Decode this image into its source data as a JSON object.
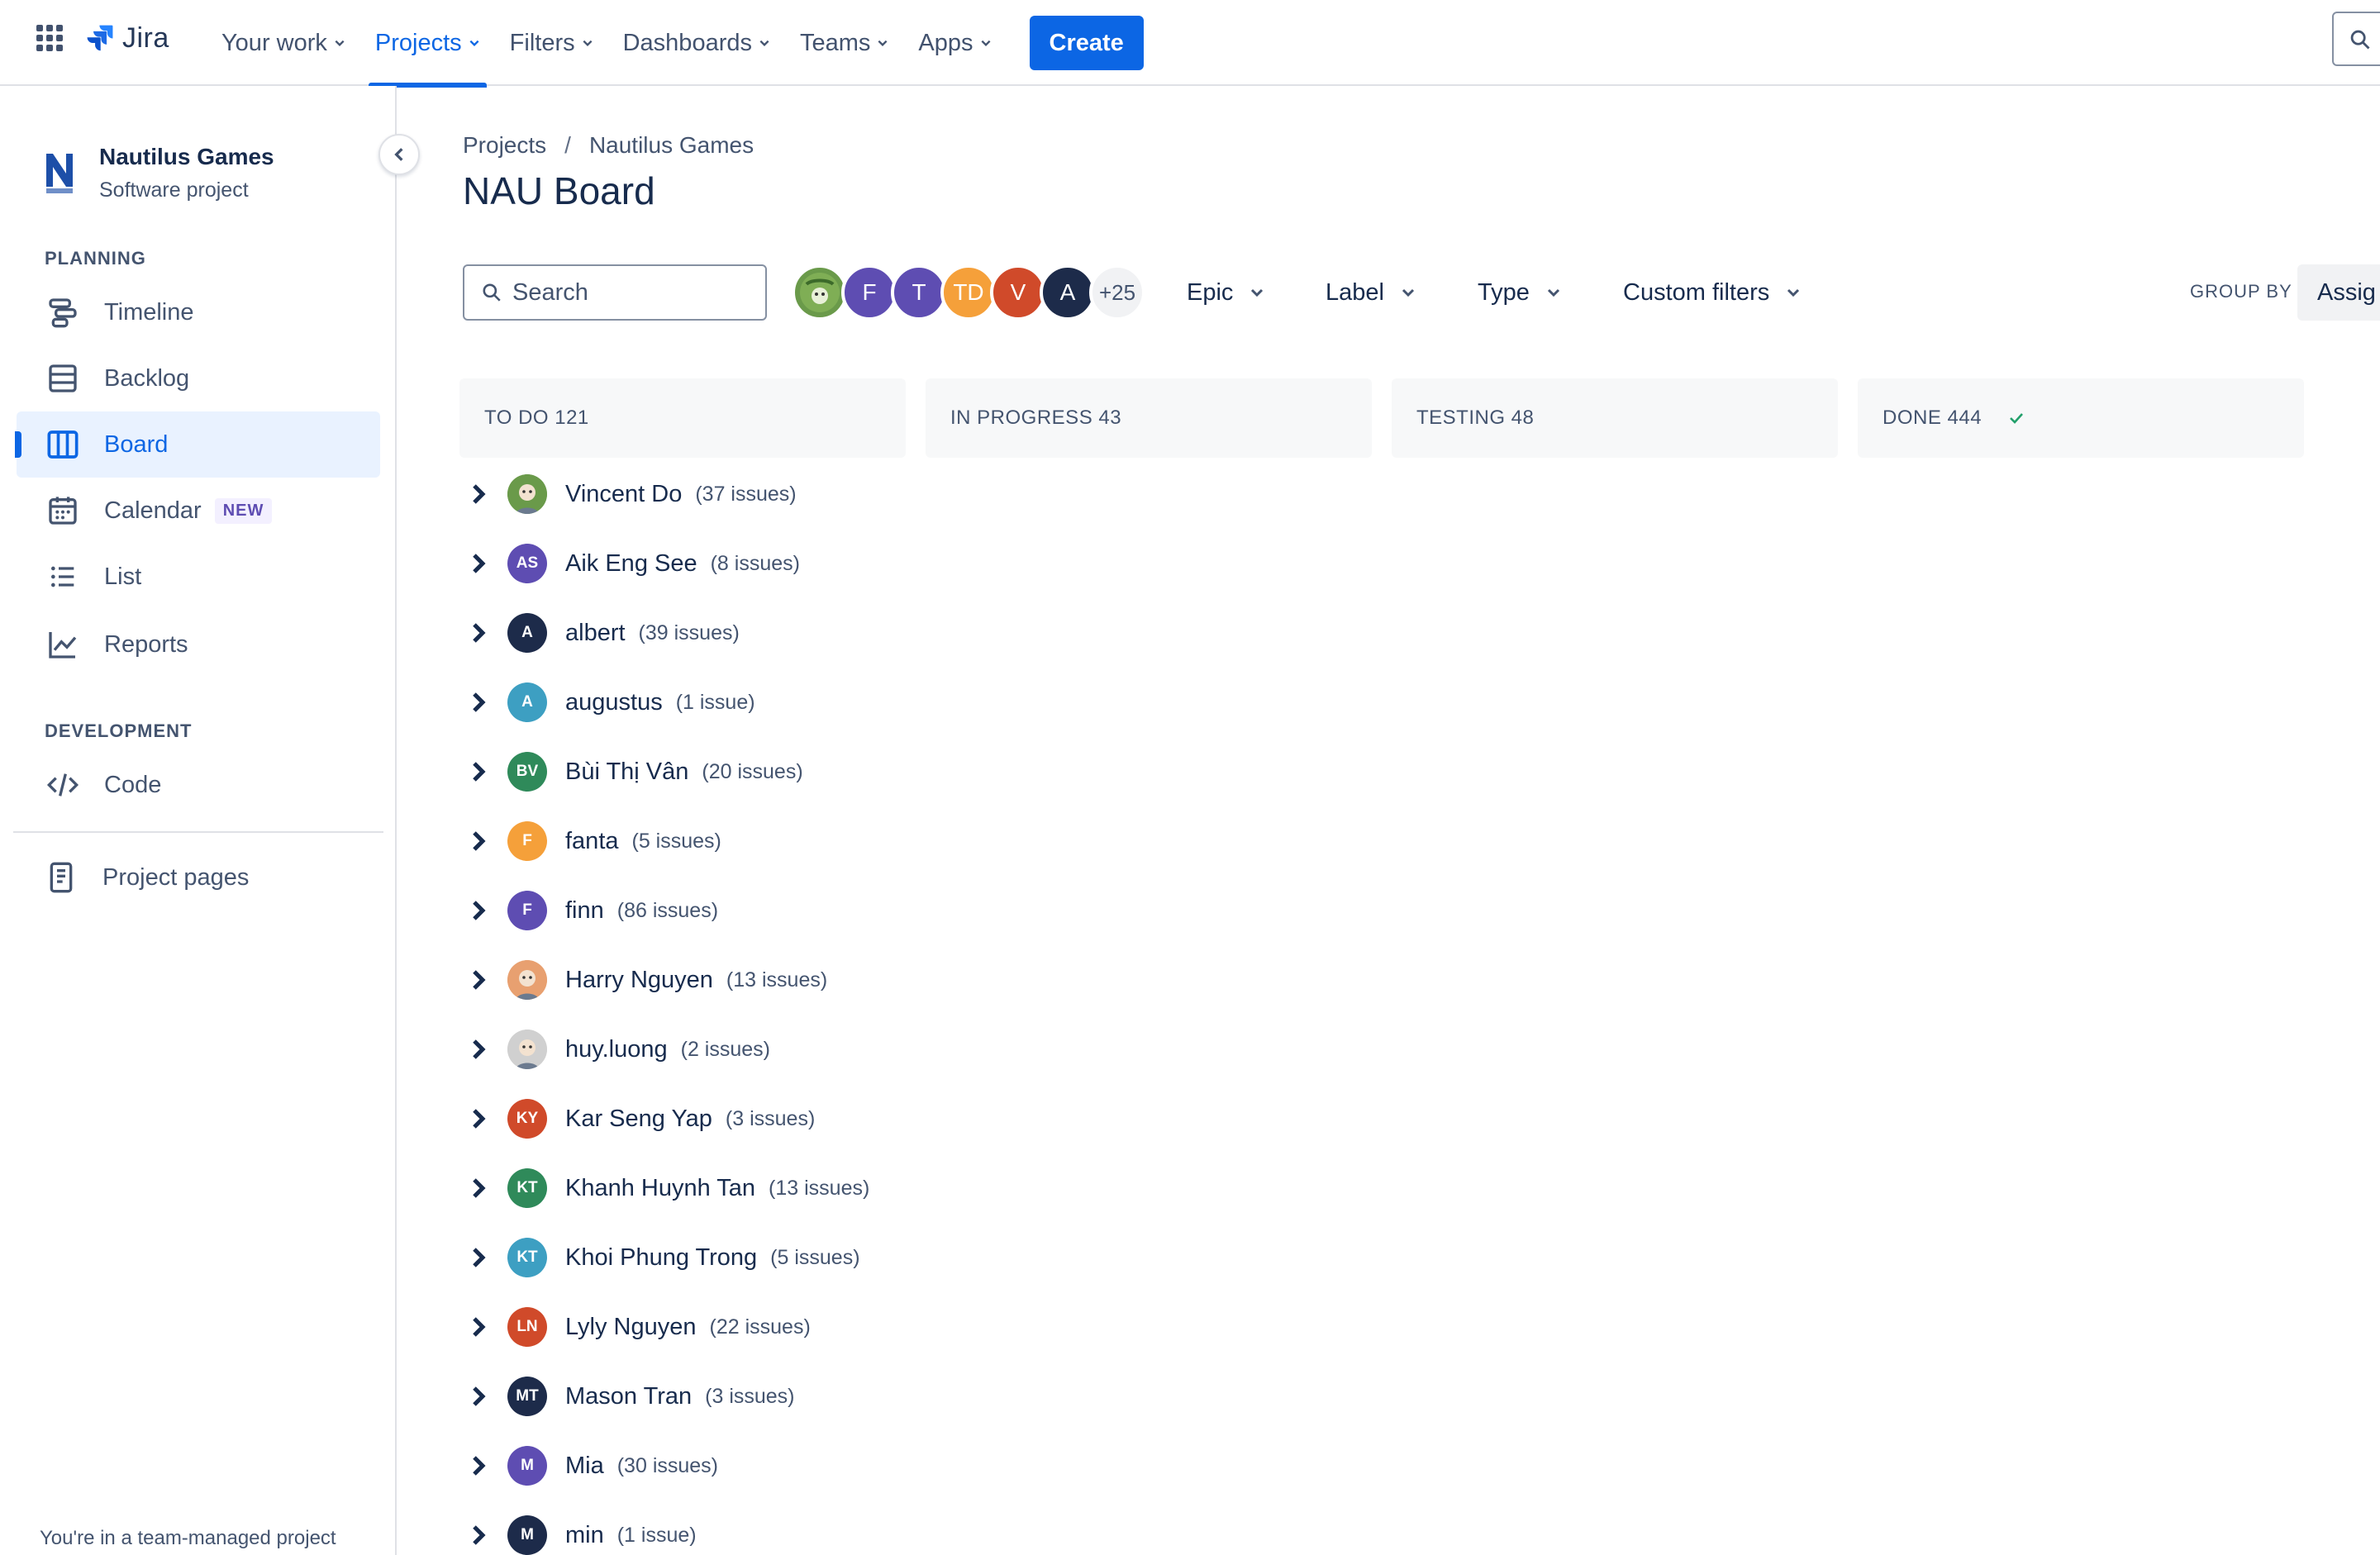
{
  "topnav": {
    "product": "Jira",
    "items": [
      {
        "label": "Your work"
      },
      {
        "label": "Projects"
      },
      {
        "label": "Filters"
      },
      {
        "label": "Dashboards"
      },
      {
        "label": "Teams"
      },
      {
        "label": "Apps"
      }
    ],
    "active_item": "Projects",
    "create_label": "Create",
    "accent": "#0c66e4"
  },
  "sidebar": {
    "project_name": "Nautilus Games",
    "project_type": "Software project",
    "planning_label": "PLANNING",
    "planning_items": [
      {
        "label": "Timeline",
        "icon": "timeline-icon"
      },
      {
        "label": "Backlog",
        "icon": "backlog-icon"
      },
      {
        "label": "Board",
        "icon": "board-icon",
        "active": true
      },
      {
        "label": "Calendar",
        "icon": "calendar-icon",
        "badge": "NEW"
      },
      {
        "label": "List",
        "icon": "list-icon"
      },
      {
        "label": "Reports",
        "icon": "reports-icon"
      }
    ],
    "development_label": "DEVELOPMENT",
    "development_items": [
      {
        "label": "Code",
        "icon": "code-icon"
      }
    ],
    "project_pages_label": "Project pages",
    "footer": "You're in a team-managed project"
  },
  "main": {
    "breadcrumb": [
      "Projects",
      "Nautilus Games"
    ],
    "title": "NAU Board",
    "search_placeholder": "Search",
    "avatars": [
      {
        "initials": "",
        "color": "#6a9a4a",
        "icon": "photo-avatar"
      },
      {
        "initials": "F",
        "color": "#5e4db2"
      },
      {
        "initials": "T",
        "color": "#5e4db2"
      },
      {
        "initials": "TD",
        "color": "#f5a03a"
      },
      {
        "initials": "V",
        "color": "#d04a2a"
      },
      {
        "initials": "A",
        "color": "#1d2b4a"
      }
    ],
    "more_avatars": "+25",
    "filters": [
      "Epic",
      "Label",
      "Type",
      "Custom filters"
    ],
    "group_by_label": "GROUP BY",
    "group_by_value": "Assig",
    "columns": [
      {
        "label": "TO DO 121"
      },
      {
        "label": "IN PROGRESS 43"
      },
      {
        "label": "TESTING 48"
      },
      {
        "label": "DONE 444",
        "done": true
      }
    ],
    "swimlanes": [
      {
        "name": "Vincent Do",
        "count": "(37 issues)",
        "initials": "",
        "color": "#6a9a4a",
        "photo": true
      },
      {
        "name": "Aik Eng See",
        "count": "(8 issues)",
        "initials": "AS",
        "color": "#5e4db2"
      },
      {
        "name": "albert",
        "count": "(39 issues)",
        "initials": "A",
        "color": "#1d2b4a"
      },
      {
        "name": "augustus",
        "count": "(1 issue)",
        "initials": "A",
        "color": "#3d9fc2"
      },
      {
        "name": "Bùi Thị Vân",
        "count": "(20 issues)",
        "initials": "BV",
        "color": "#2f8a5a"
      },
      {
        "name": "fanta",
        "count": "(5 issues)",
        "initials": "F",
        "color": "#f5a03a"
      },
      {
        "name": "finn",
        "count": "(86 issues)",
        "initials": "F",
        "color": "#5e4db2"
      },
      {
        "name": "Harry Nguyen",
        "count": "(13 issues)",
        "initials": "",
        "color": "#e8a070",
        "photo": true
      },
      {
        "name": "huy.luong",
        "count": "(2 issues)",
        "initials": "",
        "color": "#d0d0d0",
        "photo": true
      },
      {
        "name": "Kar Seng Yap",
        "count": "(3 issues)",
        "initials": "KY",
        "color": "#d04a2a"
      },
      {
        "name": "Khanh Huynh Tan",
        "count": "(13 issues)",
        "initials": "KT",
        "color": "#2f8a5a"
      },
      {
        "name": "Khoi Phung Trong",
        "count": "(5 issues)",
        "initials": "KT",
        "color": "#3d9fc2"
      },
      {
        "name": "Lyly Nguyen",
        "count": "(22 issues)",
        "initials": "LN",
        "color": "#d04a2a"
      },
      {
        "name": "Mason Tran",
        "count": "(3 issues)",
        "initials": "MT",
        "color": "#1d2b4a"
      },
      {
        "name": "Mia",
        "count": "(30 issues)",
        "initials": "M",
        "color": "#5e4db2"
      },
      {
        "name": "min",
        "count": "(1 issue)",
        "initials": "M",
        "color": "#1d2b4a"
      }
    ]
  }
}
